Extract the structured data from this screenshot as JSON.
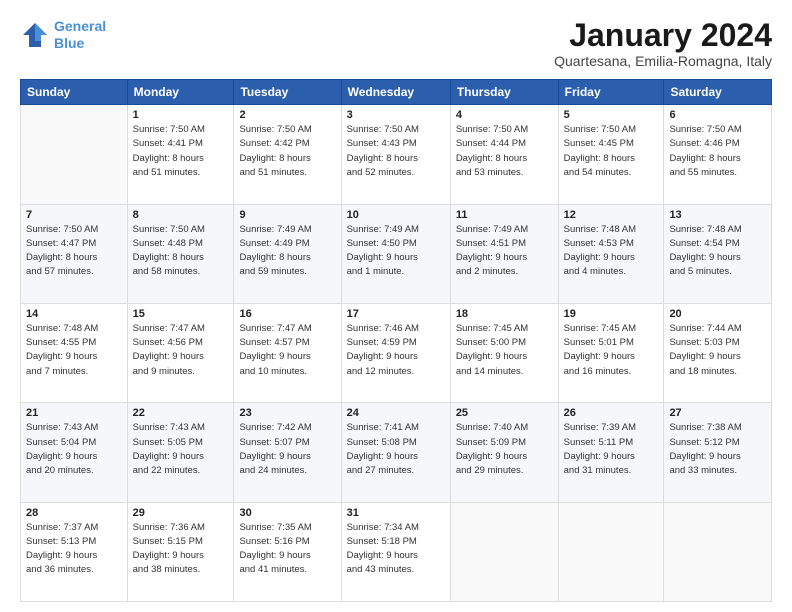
{
  "logo": {
    "line1": "General",
    "line2": "Blue"
  },
  "title": "January 2024",
  "subtitle": "Quartesana, Emilia-Romagna, Italy",
  "headers": [
    "Sunday",
    "Monday",
    "Tuesday",
    "Wednesday",
    "Thursday",
    "Friday",
    "Saturday"
  ],
  "weeks": [
    [
      {
        "day": "",
        "detail": ""
      },
      {
        "day": "1",
        "detail": "Sunrise: 7:50 AM\nSunset: 4:41 PM\nDaylight: 8 hours\nand 51 minutes."
      },
      {
        "day": "2",
        "detail": "Sunrise: 7:50 AM\nSunset: 4:42 PM\nDaylight: 8 hours\nand 51 minutes."
      },
      {
        "day": "3",
        "detail": "Sunrise: 7:50 AM\nSunset: 4:43 PM\nDaylight: 8 hours\nand 52 minutes."
      },
      {
        "day": "4",
        "detail": "Sunrise: 7:50 AM\nSunset: 4:44 PM\nDaylight: 8 hours\nand 53 minutes."
      },
      {
        "day": "5",
        "detail": "Sunrise: 7:50 AM\nSunset: 4:45 PM\nDaylight: 8 hours\nand 54 minutes."
      },
      {
        "day": "6",
        "detail": "Sunrise: 7:50 AM\nSunset: 4:46 PM\nDaylight: 8 hours\nand 55 minutes."
      }
    ],
    [
      {
        "day": "7",
        "detail": "Sunrise: 7:50 AM\nSunset: 4:47 PM\nDaylight: 8 hours\nand 57 minutes."
      },
      {
        "day": "8",
        "detail": "Sunrise: 7:50 AM\nSunset: 4:48 PM\nDaylight: 8 hours\nand 58 minutes."
      },
      {
        "day": "9",
        "detail": "Sunrise: 7:49 AM\nSunset: 4:49 PM\nDaylight: 8 hours\nand 59 minutes."
      },
      {
        "day": "10",
        "detail": "Sunrise: 7:49 AM\nSunset: 4:50 PM\nDaylight: 9 hours\nand 1 minute."
      },
      {
        "day": "11",
        "detail": "Sunrise: 7:49 AM\nSunset: 4:51 PM\nDaylight: 9 hours\nand 2 minutes."
      },
      {
        "day": "12",
        "detail": "Sunrise: 7:48 AM\nSunset: 4:53 PM\nDaylight: 9 hours\nand 4 minutes."
      },
      {
        "day": "13",
        "detail": "Sunrise: 7:48 AM\nSunset: 4:54 PM\nDaylight: 9 hours\nand 5 minutes."
      }
    ],
    [
      {
        "day": "14",
        "detail": "Sunrise: 7:48 AM\nSunset: 4:55 PM\nDaylight: 9 hours\nand 7 minutes."
      },
      {
        "day": "15",
        "detail": "Sunrise: 7:47 AM\nSunset: 4:56 PM\nDaylight: 9 hours\nand 9 minutes."
      },
      {
        "day": "16",
        "detail": "Sunrise: 7:47 AM\nSunset: 4:57 PM\nDaylight: 9 hours\nand 10 minutes."
      },
      {
        "day": "17",
        "detail": "Sunrise: 7:46 AM\nSunset: 4:59 PM\nDaylight: 9 hours\nand 12 minutes."
      },
      {
        "day": "18",
        "detail": "Sunrise: 7:45 AM\nSunset: 5:00 PM\nDaylight: 9 hours\nand 14 minutes."
      },
      {
        "day": "19",
        "detail": "Sunrise: 7:45 AM\nSunset: 5:01 PM\nDaylight: 9 hours\nand 16 minutes."
      },
      {
        "day": "20",
        "detail": "Sunrise: 7:44 AM\nSunset: 5:03 PM\nDaylight: 9 hours\nand 18 minutes."
      }
    ],
    [
      {
        "day": "21",
        "detail": "Sunrise: 7:43 AM\nSunset: 5:04 PM\nDaylight: 9 hours\nand 20 minutes."
      },
      {
        "day": "22",
        "detail": "Sunrise: 7:43 AM\nSunset: 5:05 PM\nDaylight: 9 hours\nand 22 minutes."
      },
      {
        "day": "23",
        "detail": "Sunrise: 7:42 AM\nSunset: 5:07 PM\nDaylight: 9 hours\nand 24 minutes."
      },
      {
        "day": "24",
        "detail": "Sunrise: 7:41 AM\nSunset: 5:08 PM\nDaylight: 9 hours\nand 27 minutes."
      },
      {
        "day": "25",
        "detail": "Sunrise: 7:40 AM\nSunset: 5:09 PM\nDaylight: 9 hours\nand 29 minutes."
      },
      {
        "day": "26",
        "detail": "Sunrise: 7:39 AM\nSunset: 5:11 PM\nDaylight: 9 hours\nand 31 minutes."
      },
      {
        "day": "27",
        "detail": "Sunrise: 7:38 AM\nSunset: 5:12 PM\nDaylight: 9 hours\nand 33 minutes."
      }
    ],
    [
      {
        "day": "28",
        "detail": "Sunrise: 7:37 AM\nSunset: 5:13 PM\nDaylight: 9 hours\nand 36 minutes."
      },
      {
        "day": "29",
        "detail": "Sunrise: 7:36 AM\nSunset: 5:15 PM\nDaylight: 9 hours\nand 38 minutes."
      },
      {
        "day": "30",
        "detail": "Sunrise: 7:35 AM\nSunset: 5:16 PM\nDaylight: 9 hours\nand 41 minutes."
      },
      {
        "day": "31",
        "detail": "Sunrise: 7:34 AM\nSunset: 5:18 PM\nDaylight: 9 hours\nand 43 minutes."
      },
      {
        "day": "",
        "detail": ""
      },
      {
        "day": "",
        "detail": ""
      },
      {
        "day": "",
        "detail": ""
      }
    ]
  ]
}
